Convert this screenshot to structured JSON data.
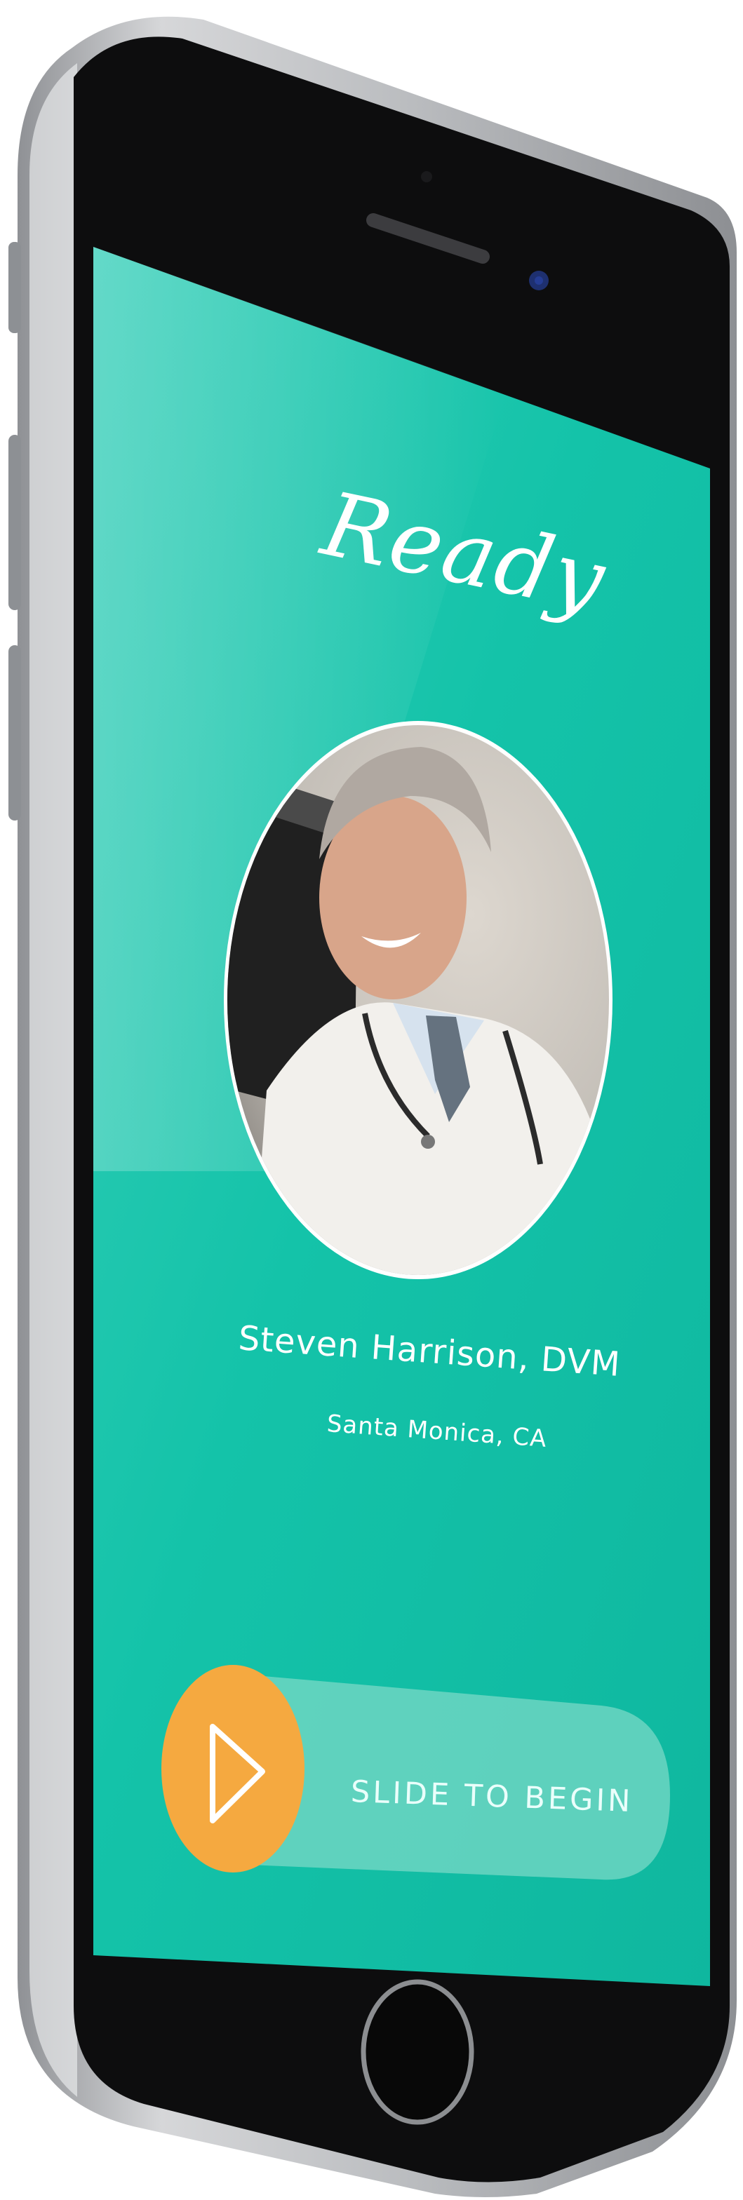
{
  "screen": {
    "title": "Ready",
    "doctor": {
      "name": "Steven Harrison, DVM",
      "location": "Santa Monica, CA"
    },
    "slider": {
      "label": "SLIDE TO BEGIN",
      "button_icon": "play-icon"
    }
  },
  "colors": {
    "screen_bg": "#12c1a7",
    "slider_track": "#7dd9c8",
    "slider_button": "#f5a940",
    "phone_frame": "#111111",
    "phone_body": "#a8aaae"
  }
}
